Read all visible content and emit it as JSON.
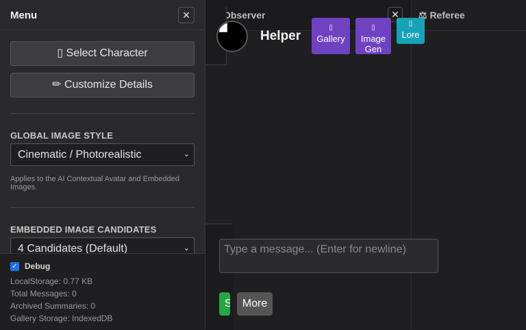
{
  "menu": {
    "title": "Menu",
    "close": "✕",
    "select_character": "▯ Select Character",
    "customize_details": "✏ Customize Details",
    "image_style_label": "GLOBAL IMAGE STYLE",
    "image_style_value": "Cinematic / Photorealistic",
    "image_style_help": "Applies to the AI Contextual Avatar and Embedded Images.",
    "candidates_label": "EMBEDDED IMAGE CANDIDATES",
    "candidates_value": "4 Candidates (Default)",
    "chevron": "⌄"
  },
  "debug": {
    "checked": true,
    "check_glyph": "✓",
    "label": "Debug",
    "local_storage": "LocalStorage: 0.77 KB",
    "total_messages": "Total Messages: 0",
    "archived_summaries": "Archived Summaries: 0",
    "gallery_storage": "Gallery Storage: IndexedDB"
  },
  "observer": {
    "title": "Observer",
    "close": "✕",
    "character_name": "Helper",
    "gallery_icon": "▯",
    "gallery_label": "Gallery",
    "imagegen_icon": "▯",
    "imagegen_label": "Image Gen",
    "lore_icon": "▯",
    "lore_label": "Lore",
    "input_placeholder": "Type a message... (Enter for newline)",
    "send_label": "Send",
    "more_label": "More"
  },
  "referee": {
    "title": "⚖ Referee"
  },
  "colors": {
    "purple": "#6f42c1",
    "teal": "#17a2b8",
    "green": "#28a745",
    "checkbox": "#1a73e8"
  }
}
